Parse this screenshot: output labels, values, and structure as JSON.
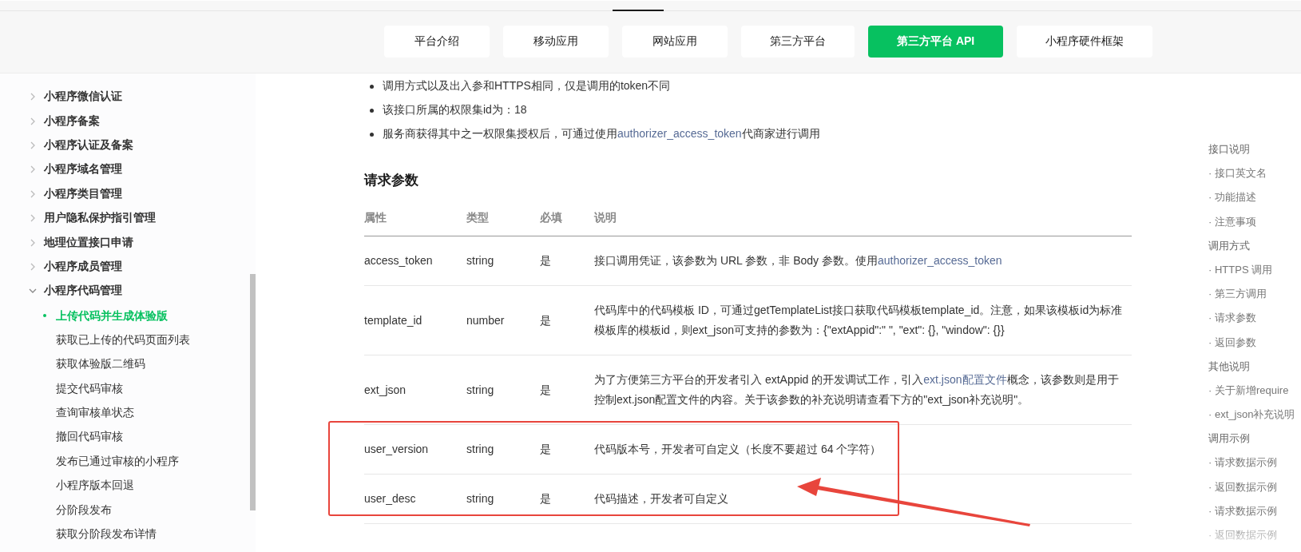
{
  "nav": {
    "tabs": [
      {
        "label": "平台介绍",
        "selected": false
      },
      {
        "label": "移动应用",
        "selected": false
      },
      {
        "label": "网站应用",
        "selected": false
      },
      {
        "label": "第三方平台",
        "selected": false
      },
      {
        "label": "第三方平台 API",
        "selected": true
      },
      {
        "label": "小程序硬件框架",
        "selected": false
      }
    ]
  },
  "sidebar": {
    "groups": [
      {
        "label": "小程序微信认证",
        "expanded": false
      },
      {
        "label": "小程序备案",
        "expanded": false
      },
      {
        "label": "小程序认证及备案",
        "expanded": false
      },
      {
        "label": "小程序域名管理",
        "expanded": false
      },
      {
        "label": "小程序类目管理",
        "expanded": false
      },
      {
        "label": "用户隐私保护指引管理",
        "expanded": false
      },
      {
        "label": "地理位置接口申请",
        "expanded": false
      },
      {
        "label": "小程序成员管理",
        "expanded": false
      },
      {
        "label": "小程序代码管理",
        "expanded": true,
        "children": [
          {
            "label": "上传代码并生成体验版",
            "selected": true
          },
          {
            "label": "获取已上传的代码页面列表",
            "selected": false
          },
          {
            "label": "获取体验版二维码",
            "selected": false
          },
          {
            "label": "提交代码审核",
            "selected": false
          },
          {
            "label": "查询审核单状态",
            "selected": false
          },
          {
            "label": "撤回代码审核",
            "selected": false
          },
          {
            "label": "发布已通过审核的小程序",
            "selected": false
          },
          {
            "label": "小程序版本回退",
            "selected": false
          },
          {
            "label": "分阶段发布",
            "selected": false
          },
          {
            "label": "获取分阶段发布详情",
            "selected": false
          }
        ]
      }
    ]
  },
  "notes": [
    [
      {
        "kind": "text",
        "text": "调用方式以及出入参和HTTPS相同，仅是调用的token不同"
      }
    ],
    [
      {
        "kind": "text",
        "text": "该接口所属的权限集id为：18"
      }
    ],
    [
      {
        "kind": "text",
        "text": "服务商获得其中之一权限集授权后，可通过使用"
      },
      {
        "kind": "link",
        "text": "authorizer_access_token"
      },
      {
        "kind": "text",
        "text": "代商家进行调用"
      }
    ]
  ],
  "section_title": "请求参数",
  "table": {
    "columns": [
      "属性",
      "类型",
      "必填",
      "说明"
    ],
    "rows": [
      {
        "name": "access_token",
        "type": "string",
        "required": "是",
        "description": [
          {
            "kind": "text",
            "text": "接口调用凭证，该参数为 URL 参数，非 Body 参数。使用"
          },
          {
            "kind": "link",
            "text": "authorizer_access_token"
          }
        ]
      },
      {
        "name": "template_id",
        "type": "number",
        "required": "是",
        "description": [
          {
            "kind": "text",
            "text": "代码库中的代码模板 ID，可通过getTemplateList接口获取代码模板template_id。注意，如果该模板id为标准模板库的模板id，则ext_json可支持的参数为：{\"extAppid\":\" \", \"ext\": {}, \"window\": {}}"
          }
        ]
      },
      {
        "name": "ext_json",
        "type": "string",
        "required": "是",
        "description": [
          {
            "kind": "text",
            "text": "为了方便第三方平台的开发者引入 extAppid 的开发调试工作，引入"
          },
          {
            "kind": "link",
            "text": "ext.json配置文件"
          },
          {
            "kind": "text",
            "text": "概念，该参数则是用于控制ext.json配置文件的内容。关于该参数的补充说明请查看下方的\"ext_json补充说明\"。"
          }
        ]
      },
      {
        "name": "user_version",
        "type": "string",
        "required": "是",
        "description": [
          {
            "kind": "text",
            "text": "代码版本号，开发者可自定义（长度不要超过 64 个字符）"
          }
        ]
      },
      {
        "name": "user_desc",
        "type": "string",
        "required": "是",
        "description": [
          {
            "kind": "text",
            "text": "代码描述，开发者可自定义"
          }
        ]
      }
    ]
  },
  "toc": [
    {
      "label": "接口说明",
      "kind": "section"
    },
    {
      "label": "· 接口英文名",
      "kind": "item"
    },
    {
      "label": "· 功能描述",
      "kind": "item"
    },
    {
      "label": "· 注意事项",
      "kind": "item"
    },
    {
      "label": "调用方式",
      "kind": "section"
    },
    {
      "label": "· HTTPS 调用",
      "kind": "item"
    },
    {
      "label": "· 第三方调用",
      "kind": "item"
    },
    {
      "label": "· 请求参数",
      "kind": "item"
    },
    {
      "label": "· 返回参数",
      "kind": "item"
    },
    {
      "label": "其他说明",
      "kind": "section"
    },
    {
      "label": "· 关于新增require",
      "kind": "item"
    },
    {
      "label": "· ext_json补充说明",
      "kind": "item"
    },
    {
      "label": "调用示例",
      "kind": "section"
    },
    {
      "label": "· 请求数据示例",
      "kind": "item"
    },
    {
      "label": "· 返回数据示例",
      "kind": "item"
    },
    {
      "label": "· 请求数据示例",
      "kind": "item"
    },
    {
      "label": "· 返回数据示例",
      "kind": "item"
    }
  ]
}
